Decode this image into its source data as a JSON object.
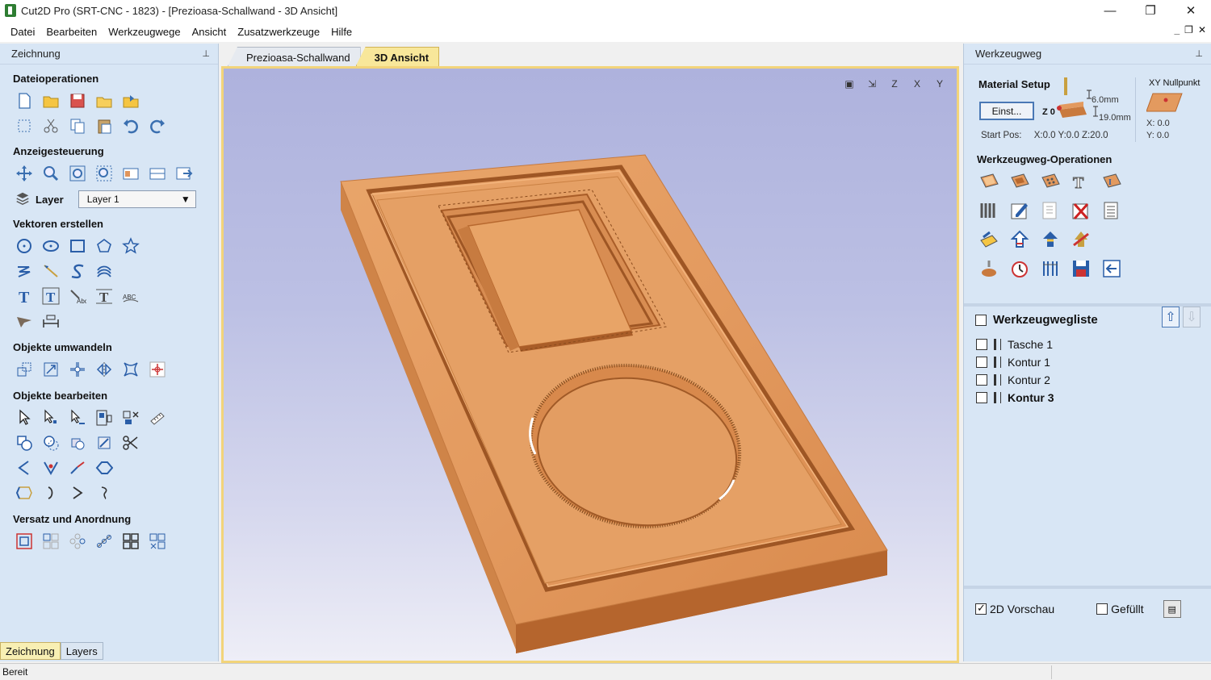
{
  "window": {
    "title": "Cut2D Pro (SRT-CNC - 1823) - [Prezioasa-Schallwand - 3D Ansicht]",
    "minimize": "—",
    "maximize": "❐",
    "close": "✕"
  },
  "menu": [
    "Datei",
    "Bearbeiten",
    "Werkzeugwege",
    "Ansicht",
    "Zusatzwerkzeuge",
    "Hilfe"
  ],
  "left_panel": {
    "title": "Zeichnung",
    "sections": {
      "file_ops": "Dateioperationen",
      "view_control": "Anzeigesteuerung",
      "create_vectors": "Vektoren erstellen",
      "transform": "Objekte umwandeln",
      "edit": "Objekte bearbeiten",
      "offset": "Versatz und Anordnung"
    },
    "layer_label": "Layer",
    "layer_value": "Layer 1",
    "tabs": [
      "Zeichnung",
      "Layers"
    ]
  },
  "doc_tabs": [
    "Prezioasa-Schallwand",
    "3D Ansicht"
  ],
  "right_panel": {
    "title": "Werkzeugweg",
    "material_setup": "Material Setup",
    "einst_button": "Einst...",
    "z0_label": "Z 0",
    "thickness_top": "6.0mm",
    "thickness_total": "19.0mm",
    "start_pos_label": "Start Pos:",
    "start_pos_value": "X:0.0 Y:0.0 Z:20.0",
    "xy_zero_label": "XY Nullpunkt",
    "xy_x": "X: 0.0",
    "xy_y": "Y: 0.0",
    "ops_title": "Werkzeugweg-Operationen",
    "toolpath_list_title": "Werkzeugwegliste",
    "toolpaths": [
      "Tasche 1",
      "Kontur 1",
      "Kontur 2",
      "Kontur 3"
    ],
    "preview_2d": "2D Vorschau",
    "filled": "Gefüllt"
  },
  "status": "Bereit",
  "colors": {
    "panel_bg": "#d8e6f5",
    "active_tab": "#f8e79a",
    "wood_top": "#e0955c",
    "wood_side": "#b8692f"
  }
}
